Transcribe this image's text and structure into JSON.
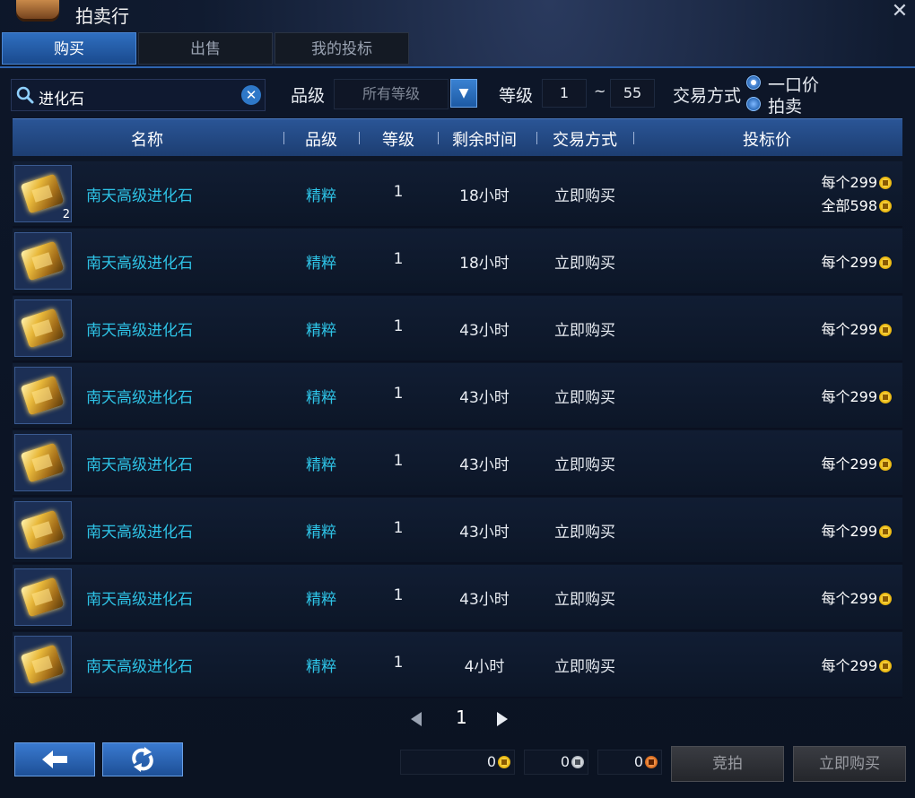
{
  "window": {
    "title": "拍卖行",
    "close_glyph": "✕"
  },
  "tabs": [
    {
      "label": "购买",
      "active": true
    },
    {
      "label": "出售",
      "active": false
    },
    {
      "label": "我的投标",
      "active": false
    }
  ],
  "filters": {
    "search_value": "进化石",
    "grade_label": "品级",
    "grade_value": "所有等级",
    "level_label": "等级",
    "level_min": "1",
    "level_sep": "~",
    "level_max": "55",
    "trade_label": "交易方式",
    "trade_options": [
      {
        "label": "一口价",
        "selected": true
      },
      {
        "label": "拍卖",
        "selected": false
      }
    ]
  },
  "columns": [
    "名称",
    "品级",
    "等级",
    "剩余时间",
    "交易方式",
    "投标价"
  ],
  "rows": [
    {
      "name": "南天高级进化石",
      "grade": "精粹",
      "level": "1",
      "time": "18小时",
      "trade": "立即购买",
      "count": "2",
      "price_each": "每个299",
      "price_total": "全部598"
    },
    {
      "name": "南天高级进化石",
      "grade": "精粹",
      "level": "1",
      "time": "18小时",
      "trade": "立即购买",
      "count": "",
      "price_each": "每个299",
      "price_total": ""
    },
    {
      "name": "南天高级进化石",
      "grade": "精粹",
      "level": "1",
      "time": "43小时",
      "trade": "立即购买",
      "count": "",
      "price_each": "每个299",
      "price_total": ""
    },
    {
      "name": "南天高级进化石",
      "grade": "精粹",
      "level": "1",
      "time": "43小时",
      "trade": "立即购买",
      "count": "",
      "price_each": "每个299",
      "price_total": ""
    },
    {
      "name": "南天高级进化石",
      "grade": "精粹",
      "level": "1",
      "time": "43小时",
      "trade": "立即购买",
      "count": "",
      "price_each": "每个299",
      "price_total": ""
    },
    {
      "name": "南天高级进化石",
      "grade": "精粹",
      "level": "1",
      "time": "43小时",
      "trade": "立即购买",
      "count": "",
      "price_each": "每个299",
      "price_total": ""
    },
    {
      "name": "南天高级进化石",
      "grade": "精粹",
      "level": "1",
      "time": "43小时",
      "trade": "立即购买",
      "count": "",
      "price_each": "每个299",
      "price_total": ""
    },
    {
      "name": "南天高级进化石",
      "grade": "精粹",
      "level": "1",
      "time": "4小时",
      "trade": "立即购买",
      "count": "",
      "price_each": "每个299",
      "price_total": ""
    }
  ],
  "pagination": {
    "page": "1"
  },
  "footer": {
    "gold": "0",
    "silver": "0",
    "copper": "0",
    "bid_label": "竞拍",
    "buy_label": "立即购买"
  },
  "icons": {
    "back": "back-arrow-icon",
    "refresh": "refresh-icon",
    "search": "search-icon",
    "clear": "clear-icon",
    "item": "evolution-stone-icon",
    "coin_gold": "gold-coin-icon",
    "coin_silver": "silver-coin-icon",
    "coin_copper": "copper-coin-icon"
  }
}
